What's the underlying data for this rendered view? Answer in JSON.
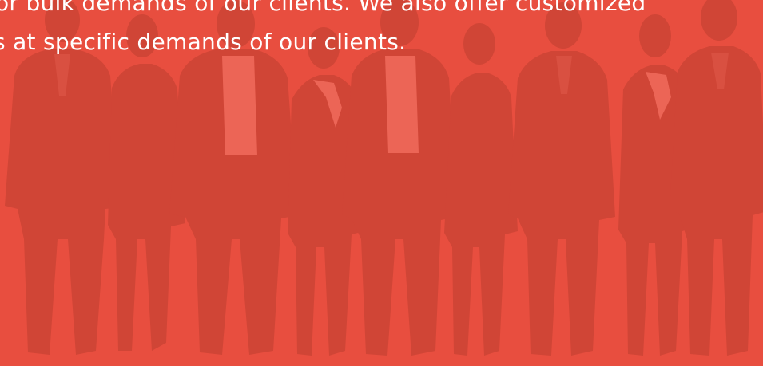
{
  "banner": {
    "background_color": "#e84e3f",
    "silhouette_color": "#d04536",
    "text_lines": [
      "or bulk demands of our clients. We also offer customized",
      "s at specific demands of our clients."
    ]
  }
}
